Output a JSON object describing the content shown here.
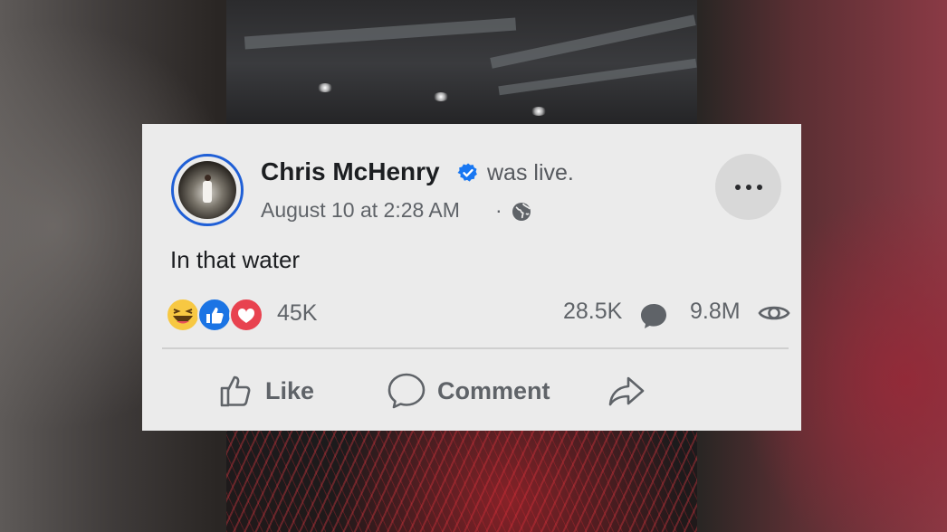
{
  "post": {
    "author_name": "Chris McHenry",
    "verified": true,
    "status": "was live.",
    "date": "August 10 at 2:28 AM",
    "separator": "·",
    "privacy_icon": "globe-icon",
    "text": "In that water"
  },
  "stats": {
    "reactions": [
      "haha-reaction",
      "like-reaction",
      "love-reaction"
    ],
    "reaction_count": "45K",
    "comment_count": "28.5K",
    "view_count": "9.8M"
  },
  "actions": {
    "like_label": "Like",
    "comment_label": "Comment"
  },
  "colors": {
    "card_background": "#ebebeb",
    "verified_blue": "#1877f2",
    "avatar_ring": "#1f5fd6",
    "text_primary": "#1c1e21",
    "text_secondary": "#5f6368"
  }
}
